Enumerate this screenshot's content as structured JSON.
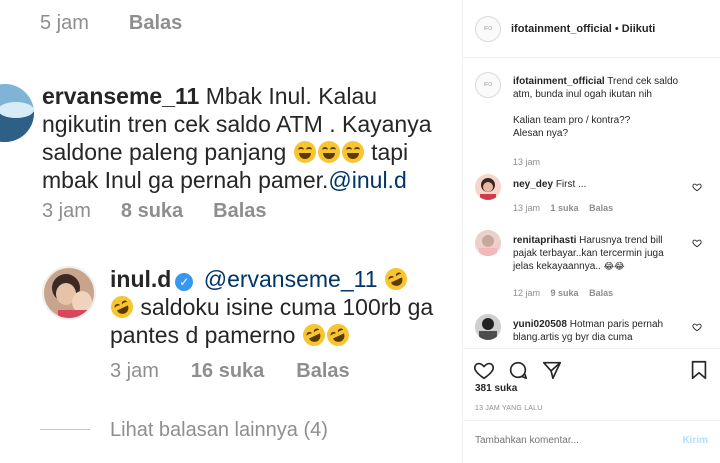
{
  "left": {
    "top_row": {
      "time": "5 jam",
      "reply": "Balas"
    },
    "comment1": {
      "username": "ervanseme_11",
      "line1": "Mbak Inul. Kalau",
      "line2": "ngikutin tren cek saldo ATM . Kayanya",
      "line3a": "saldone paleng panjang",
      "line3b": "tapi",
      "line4a": "mbak Inul ga pernah pamer.",
      "line4_mention": "@inul.d",
      "time": "3 jam",
      "likes": "8 suka",
      "reply": "Balas"
    },
    "reply1": {
      "username": "inul.d",
      "mention": "@ervanseme_11",
      "line2": "saldoku isine cuma 100rb ga",
      "line3": "pantes d pamerno",
      "time": "3 jam",
      "likes": "16 suka",
      "reply": "Balas"
    },
    "more_replies": "Lihat balasan lainnya (4)"
  },
  "panel": {
    "header": {
      "username": "ifotainment_official",
      "dot": "•",
      "follow_state": "Diikuti"
    },
    "caption": {
      "username": "ifotainment_official",
      "text1": "Trend cek saldo atm, bunda inul ogah ikutan nih",
      "text2": "Kalian team pro / kontra??",
      "text3": "Alesan nya?",
      "time": "13 jam"
    },
    "comments": [
      {
        "username": "ney_dey",
        "text": "First ...",
        "time": "13 jam",
        "likes": "1 suka",
        "reply": "Balas"
      },
      {
        "username": "renitaprihasti",
        "text": "Harusnya trend bill pajak terbayar..kan tercermin juga jelas kekayaannya..",
        "time": "12 jam",
        "likes": "9 suka",
        "reply": "Balas"
      },
      {
        "username": "yuni020508",
        "text": "Hotman paris pernah blang.artis yg byr dia cuma"
      }
    ],
    "likes_count": "381 suka",
    "posted_ago": "13 JAM YANG LALU",
    "compose": {
      "placeholder": "Tambahkan komentar...",
      "send": "Kirim"
    },
    "colors": {
      "link": "#003569",
      "send_disabled": "#b2dffc",
      "verified": "#3897f0"
    }
  }
}
